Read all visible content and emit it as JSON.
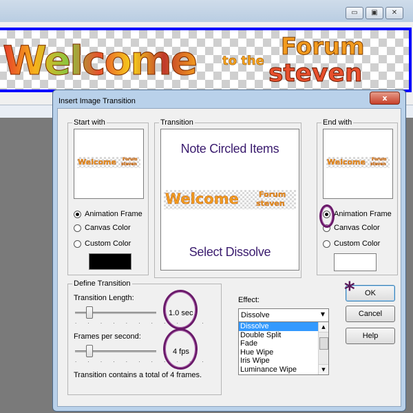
{
  "dialog": {
    "title": "Insert Image Transition",
    "close_glyph": "x"
  },
  "banner": {
    "welcome": "Welcome",
    "to_the": "to the",
    "forum": "Forum",
    "name": "steven"
  },
  "start_with": {
    "label": "Start with",
    "options": [
      "Animation Frame",
      "Canvas Color",
      "Custom Color"
    ],
    "selected": "Animation Frame",
    "custom_color": "#000000"
  },
  "transition": {
    "label": "Transition",
    "note_top": "Note Circled Items",
    "note_bottom": "Select Dissolve"
  },
  "end_with": {
    "label": "End with",
    "options": [
      "Animation Frame",
      "Canvas Color",
      "Custom Color"
    ],
    "selected": "Animation Frame",
    "custom_color": "#ffffff"
  },
  "define": {
    "label": "Define Transition",
    "length_label": "Transition Length:",
    "length_value": "1.0 sec",
    "fps_label": "Frames per second:",
    "fps_value": "4 fps",
    "summary": "Transition contains a total of 4 frames.",
    "ticks": ". . . . . . . . . . ."
  },
  "effect": {
    "label": "Effect:",
    "selected": "Dissolve",
    "options": [
      "Dissolve",
      "Double Split",
      "Fade",
      "Hue Wipe",
      "Iris Wipe",
      "Luminance Wipe"
    ]
  },
  "buttons": {
    "ok": "OK",
    "cancel": "Cancel",
    "help": "Help"
  },
  "window_buttons": {
    "minimize": "▭",
    "maximize": "▣",
    "close": "✕"
  },
  "colors": {
    "banner_border": "#0000ff",
    "circle_annotation": "#6a1a6a",
    "selection": "#3399ff"
  }
}
